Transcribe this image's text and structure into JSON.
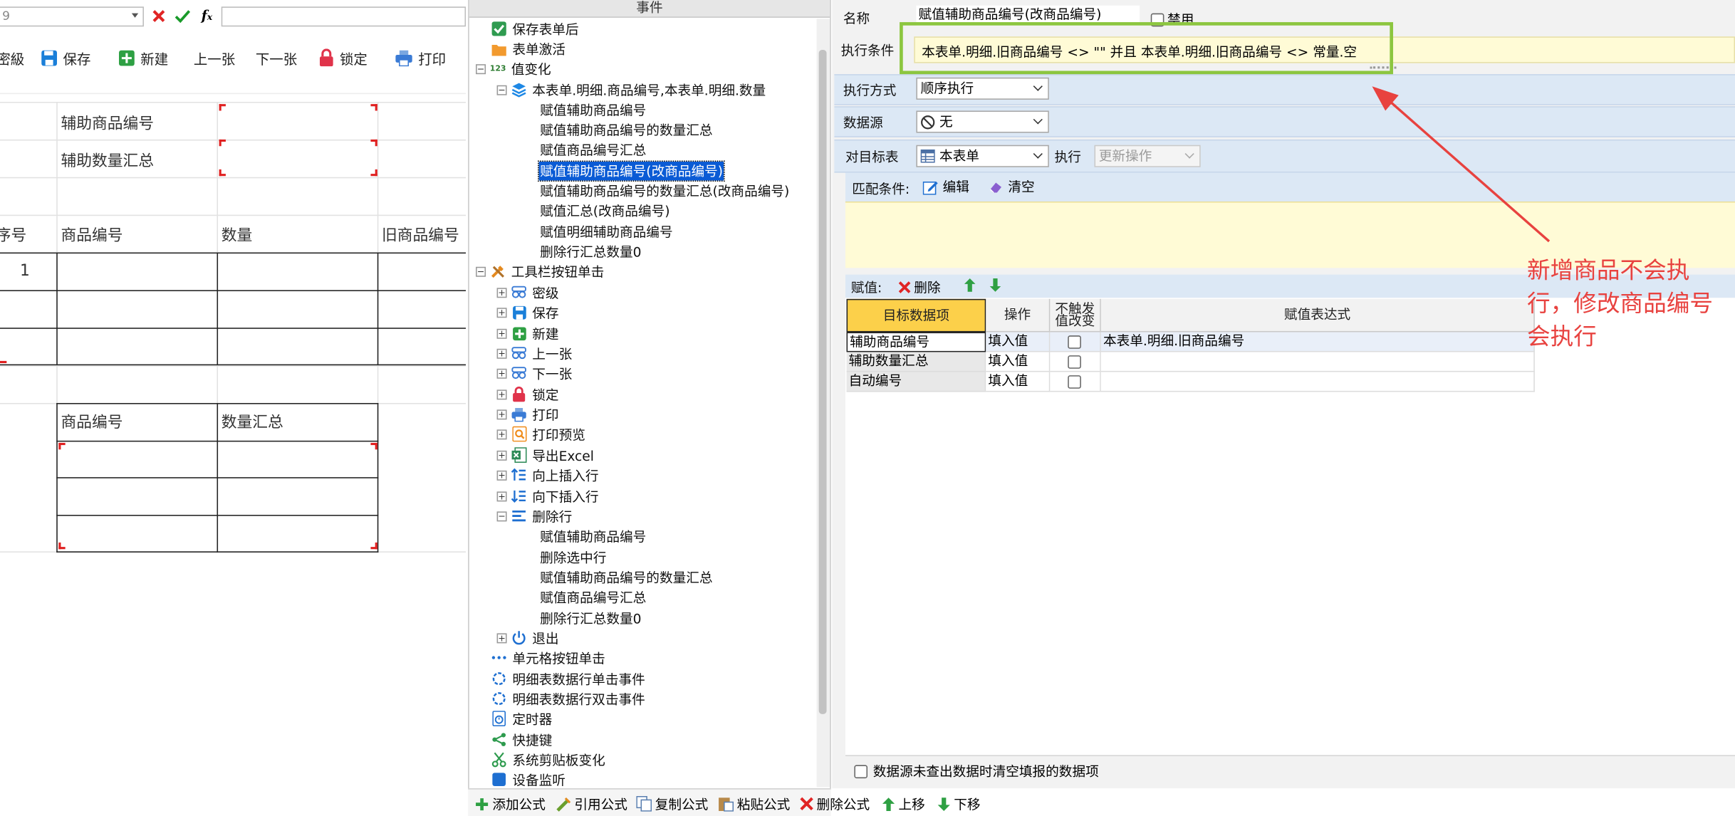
{
  "formula_bar": {
    "combo_value": "9"
  },
  "toolbar": {
    "items": [
      "密級",
      "保存",
      "新建",
      "上一张",
      "下一张",
      "锁定",
      "打印"
    ]
  },
  "form": {
    "aux_code_label": "辅助商品编号",
    "aux_qty_label": "辅助数量汇总",
    "detail_headers": [
      "序号",
      "商品编号",
      "数量",
      "旧商品编号"
    ],
    "detail_row1_index": "1",
    "summary_headers": [
      "商品编号",
      "数量汇总"
    ]
  },
  "events_panel": {
    "header": "事件",
    "nodes": [
      "保存表单后",
      "表单激活",
      "值变化",
      "本表单.明细.商品编号,本表单.明细.数量",
      "赋值辅助商品编号",
      "赋值辅助商品编号的数量汇总",
      "赋值商品编号汇总",
      "赋值辅助商品编号(改商品编号)",
      "赋值辅助商品编号的数量汇总(改商品编号)",
      "赋值汇总(改商品编号)",
      "赋值明细辅助商品编号",
      "删除行汇总数量0",
      "工具栏按钮单击",
      "密级",
      "保存",
      "新建",
      "上一张",
      "下一张",
      "锁定",
      "打印",
      "打印预览",
      "导出Excel",
      "向上插入行",
      "向下插入行",
      "删除行",
      "赋值辅助商品编号",
      "删除选中行",
      "赋值辅助商品编号的数量汇总",
      "赋值商品编号汇总",
      "删除行汇总数量0",
      "退出",
      "单元格按钮单击",
      "明细表数据行单击事件",
      "明细表数据行双击事件",
      "定时器",
      "快捷键",
      "系统剪贴板变化",
      "设备监听"
    ],
    "num_badge": "123",
    "bottom_toolbar": [
      "添加公式",
      "引用公式",
      "复制公式",
      "粘贴公式",
      "删除公式",
      "上移",
      "下移"
    ]
  },
  "properties": {
    "name_label": "名称",
    "name_value": "赋值辅助商品编号(改商品编号)",
    "disable_label": "禁用",
    "condition_label": "执行条件",
    "condition_value": "本表单.明细.旧商品编号 <> \"\" 并且 本表单.明细.旧商品编号 <> 常量.空",
    "exec_mode_label": "执行方式",
    "exec_mode_value": "顺序执行",
    "datasource_label": "数据源",
    "datasource_value": "无",
    "target_label": "对目标表",
    "target_value": "本表单",
    "exec_label": "执行",
    "exec_value": "更新操作",
    "match_label": "匹配条件:",
    "edit_label": "编辑",
    "clear_label": "清空",
    "assign_label": "赋值:",
    "delete_label": "删除",
    "grid_headers": [
      "目标数据项",
      "操作",
      "不触发值改变",
      "赋值表达式"
    ],
    "grid_rows": [
      {
        "target": "辅助商品编号",
        "op": "填入值",
        "expr": "本表单.明细.旧商品编号"
      },
      {
        "target": "辅助数量汇总",
        "op": "填入值",
        "expr": ""
      },
      {
        "target": "自动编号",
        "op": "填入值",
        "expr": ""
      }
    ],
    "footer_checkbox_label": "数据源未查出数据时清空填报的数据项"
  },
  "annotation": {
    "text": "新增商品不会执行，修改商品编号会执行",
    "color": "#e8423f",
    "highlight_color": "#8cc63f"
  }
}
